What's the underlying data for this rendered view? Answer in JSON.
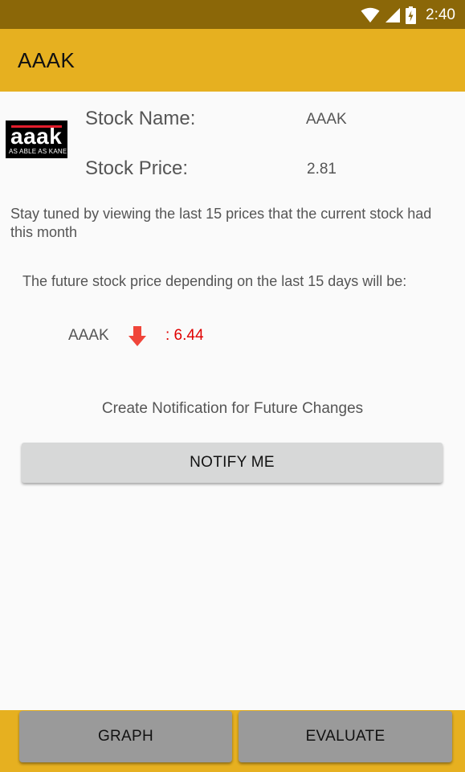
{
  "status_bar": {
    "time": "2:40",
    "icons": [
      "wifi-icon",
      "cell-signal-icon",
      "battery-charging-icon"
    ]
  },
  "app_bar": {
    "title": "AAAK"
  },
  "logo": {
    "word": "aaak",
    "tagline": "AS ABLE AS KANE"
  },
  "stock": {
    "name_label": "Stock Name:",
    "name_value": "AAAK",
    "price_label": "Stock Price:",
    "price_value": "2.81"
  },
  "info_text": "Stay tuned by viewing the last 15 prices that the current stock had this month",
  "future_text": "The future stock price depending on the last 15 days will be:",
  "prediction": {
    "ticker": "AAAK",
    "direction": "down",
    "value": ": 6.44",
    "color": "#e00000"
  },
  "notification": {
    "caption": "Create Notification for Future Changes",
    "button_label": "NOTIFY ME"
  },
  "bottom_nav": {
    "graph_label": "GRAPH",
    "evaluate_label": "EVALUATE"
  },
  "colors": {
    "accent": "#e6b020",
    "status_bar": "#8b6708",
    "arrow": "#f0453a"
  }
}
